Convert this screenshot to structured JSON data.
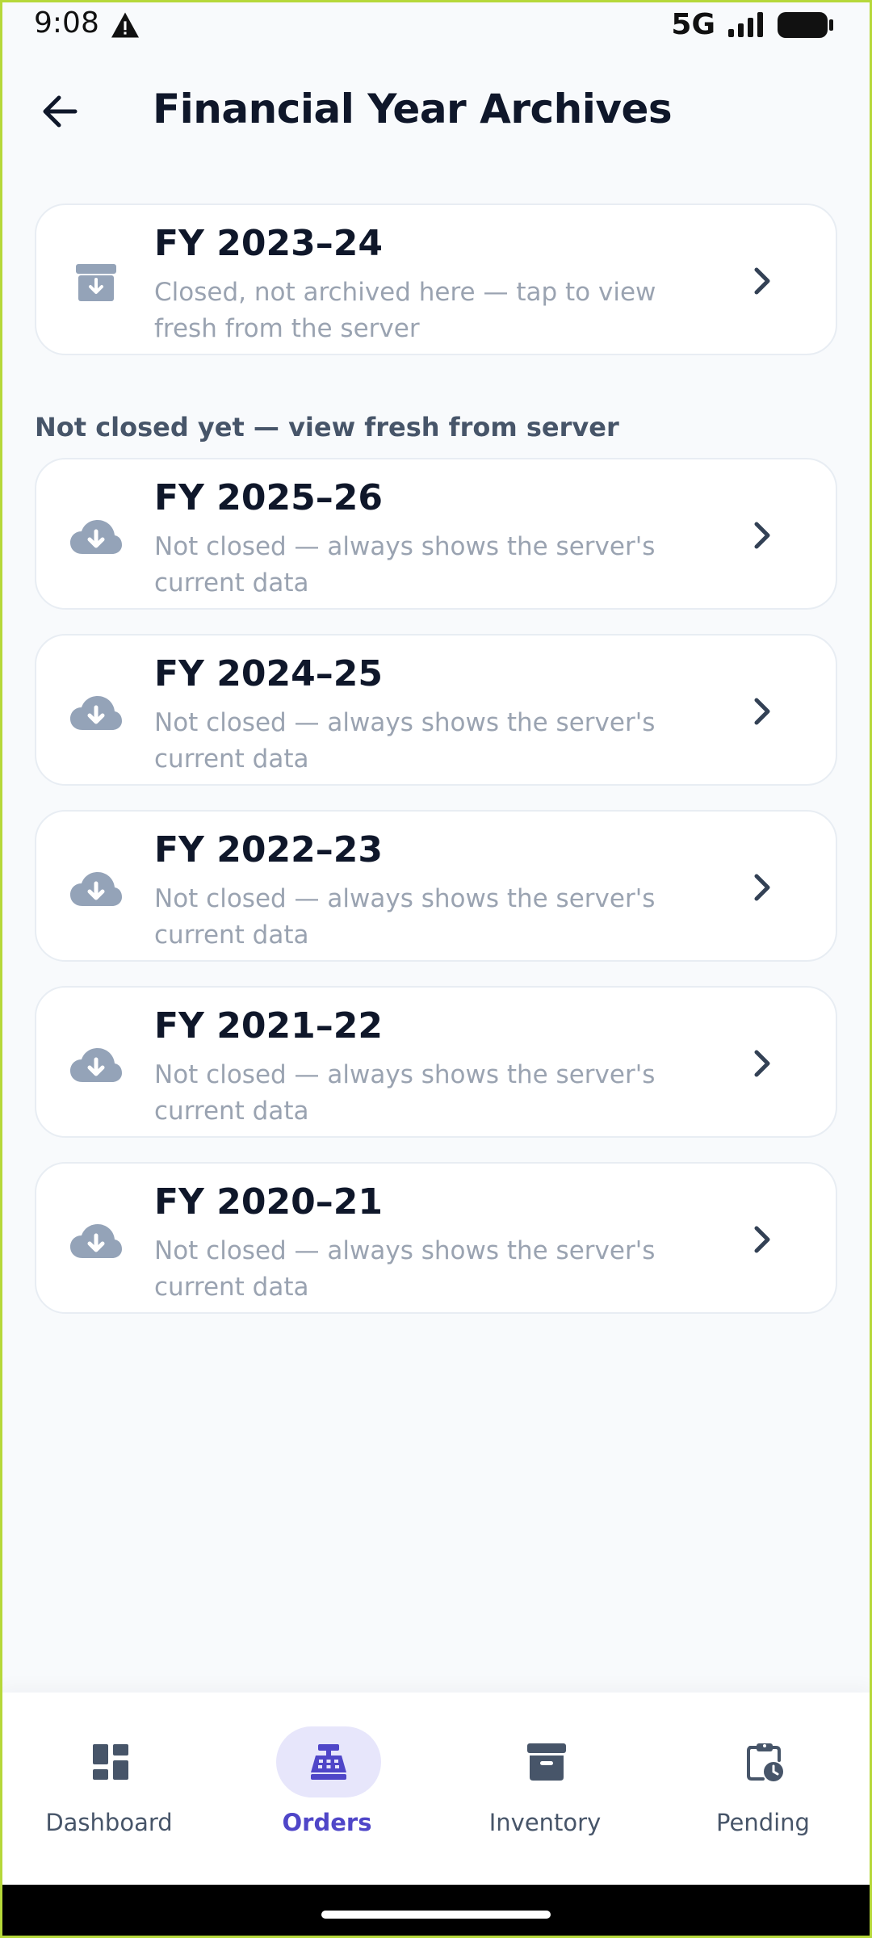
{
  "status_bar": {
    "time": "9:08",
    "network": "5G",
    "icons": [
      "warning-icon",
      "signal-icon",
      "battery-icon"
    ]
  },
  "header": {
    "title": "Financial Year Archives",
    "back_icon": "arrow-left-icon"
  },
  "archived": [
    {
      "title": "FY 2023–24",
      "subtitle": "Closed, not archived here — tap to view fresh from the server",
      "icon": "archive-box-icon"
    }
  ],
  "section_label": "Not closed yet — view fresh from server",
  "open_years": [
    {
      "title": "FY 2025–26",
      "subtitle": "Not closed — always shows the server's current data",
      "icon": "cloud-download-icon"
    },
    {
      "title": "FY 2024–25",
      "subtitle": "Not closed — always shows the server's current data",
      "icon": "cloud-download-icon"
    },
    {
      "title": "FY 2022–23",
      "subtitle": "Not closed — always shows the server's current data",
      "icon": "cloud-download-icon"
    },
    {
      "title": "FY 2021–22",
      "subtitle": "Not closed — always shows the server's current data",
      "icon": "cloud-download-icon"
    },
    {
      "title": "FY 2020–21",
      "subtitle": "Not closed — always shows the server's current data",
      "icon": "cloud-download-icon"
    }
  ],
  "bottom_nav": [
    {
      "label": "Dashboard",
      "icon": "dashboard-icon",
      "active": false
    },
    {
      "label": "Orders",
      "icon": "cash-register-icon",
      "active": true
    },
    {
      "label": "Inventory",
      "icon": "archive-icon",
      "active": false
    },
    {
      "label": "Pending",
      "icon": "clipboard-clock-icon",
      "active": false
    }
  ],
  "colors": {
    "accent": "#4f46c8",
    "accent_bg": "#e7e6fb",
    "icon_muted": "#94a3b8",
    "nav_icon": "#475569",
    "background": "#f8fafc"
  }
}
